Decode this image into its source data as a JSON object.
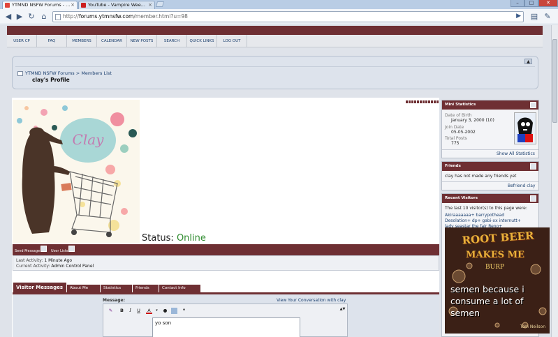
{
  "browser": {
    "tabs": [
      {
        "title": "YTMND NSFW Forums - ...",
        "active": true
      },
      {
        "title": "YouTube - Vampire Wee...",
        "active": false
      }
    ],
    "url_prefix": "http://",
    "url_domain": "forums.ytmnsfw.com",
    "url_path": "/member.html?u=98"
  },
  "menu": [
    "USER CP",
    "FAQ",
    "MEMBERS",
    "CALENDAR",
    "NEW POSTS",
    "SEARCH",
    "QUICK LINKS",
    "LOG OUT"
  ],
  "breadcrumb": {
    "forum": "YTMND NSFW Forums",
    "separator": ">",
    "section": "Members List",
    "page_title": "clay's Profile"
  },
  "profile": {
    "status_label": "Status:",
    "status_value": "Online",
    "send_message": "Send Message",
    "user_lists": "User Lists",
    "last_activity_label": "Last Activity:",
    "last_activity_value": "1 Minute Ago",
    "current_activity_label": "Current Activity:",
    "current_activity_value": "Admin Control Panel",
    "image_text": "Clay"
  },
  "profile_tabs": [
    "Visitor Messages",
    "About Me",
    "Statistics",
    "Friends",
    "Contact Info"
  ],
  "message": {
    "label": "Message:",
    "view_convo": "View Your Conversation with clay",
    "text": "yo son"
  },
  "sidebar": {
    "mini_stats": {
      "title": "Mini Statistics",
      "dob_label": "Date of Birth",
      "dob_value": "January 3, 2000 (10)",
      "join_label": "Join Date",
      "join_value": "05-05-2002",
      "posts_label": "Total Posts",
      "posts_value": "775",
      "show_all": "Show All Statistics"
    },
    "friends": {
      "title": "Friends",
      "text": "clay has not made any friends yet",
      "befriend": "Befriend clay"
    },
    "visitors": {
      "title": "Recent Visitors",
      "intro": "The last 10 visitor(s) to this page were:",
      "names_line1": "Akiraaaaaaa+  barrypothead",
      "names_line2": "Desolation+  dp+  gabi-xx  internutt+",
      "names_line3": "lady seastar the fair  Reno+"
    }
  },
  "overlay": {
    "title1": "ROOT BEER",
    "title2": "MAKES ME",
    "title3": "BURP",
    "caption": "semen because i consume a lot of semen",
    "author": "Tom Neilson"
  }
}
